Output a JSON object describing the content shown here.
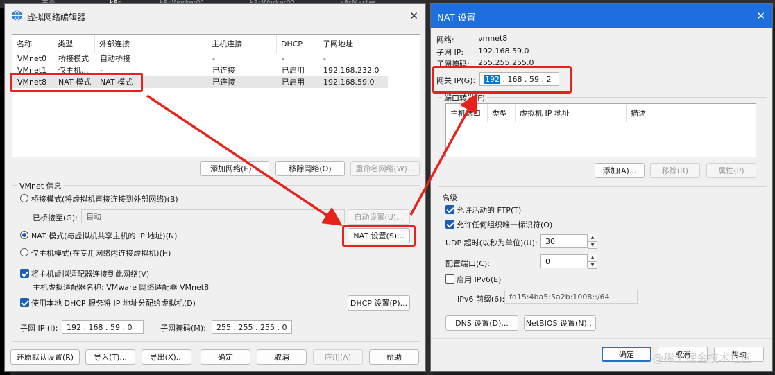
{
  "background": {
    "tabs": [
      "主页",
      "k8s",
      "k8sWorker01",
      "k8sWorker02",
      "k8sMaster"
    ]
  },
  "left_window": {
    "title": "虚拟网络编辑器",
    "icon": "globe-icon",
    "table": {
      "headers": [
        "名称",
        "类型",
        "外部连接",
        "主机连接",
        "DHCP",
        "子网地址"
      ],
      "rows": [
        [
          "VMnet0",
          "桥接模式",
          "自动桥接",
          "-",
          "-",
          "-"
        ],
        [
          "VMnet1",
          "仅主机...",
          "-",
          "已连接",
          "已启用",
          "192.168.232.0"
        ],
        [
          "VMnet8",
          "NAT 模式",
          "NAT 模式",
          "已连接",
          "已启用",
          "192.168.59.0"
        ]
      ]
    },
    "list_buttons": {
      "add": "添加网络(E)...",
      "remove": "移除网络(O)",
      "rename": "重命名网络(W)..."
    },
    "info_label": "VMnet 信息",
    "bridge_radio": "桥接模式(将虚拟机直接连接到外部网络)(B)",
    "bridged_to_label": "已桥接至(G):",
    "bridged_to_value": "自动",
    "auto_settings": "自动设置(U)...",
    "nat_radio": "NAT 模式(与虚拟机共享主机的 IP 地址)(N)",
    "nat_settings": "NAT 设置(S)...",
    "hostonly_radio": "仅主机模式(在专用网络内连接虚拟机)(H)",
    "connect_adapter": "将主机虚拟适配器连接到此网络(V)",
    "adapter_name": "主机虚拟适配器名称: VMware 网络适配器 VMnet8",
    "use_dhcp": "使用本地 DHCP 服务将 IP 地址分配给虚拟机(D)",
    "dhcp_settings": "DHCP 设置(P)...",
    "subnet_ip_label": "子网 IP (I):",
    "subnet_ip": "192 . 168 . 59 . 0",
    "subnet_mask_label": "子网掩码(M):",
    "subnet_mask": "255 . 255 . 255 . 0",
    "footer": {
      "restore": "还原默认设置(R)",
      "import": "导入(T)...",
      "export": "导出(X)...",
      "ok": "确定",
      "cancel": "取消",
      "apply": "应用(A)",
      "help": "帮助"
    }
  },
  "nat_window": {
    "title": "NAT 设置",
    "network_label": "网络:",
    "network_value": "vmnet8",
    "subnet_ip_label": "子网 IP:",
    "subnet_ip_value": "192.168.59.0",
    "subnet_mask_label": "子网掩码:",
    "subnet_mask_value": "255.255.255.0",
    "gateway_label": "网关 IP(G):",
    "gateway_first": "192",
    "gateway_rest": " . 168 . 59 . 2",
    "port_forward_label": "端口转发(F)",
    "pf_headers": [
      "主机端口",
      "类型",
      "虚拟机 IP 地址",
      "描述"
    ],
    "pf_buttons": {
      "add": "添加(A)...",
      "remove": "移除(R)",
      "props": "属性(P)"
    },
    "advanced_label": "高级",
    "allow_ftp": "允许活动的 FTP(T)",
    "allow_uuid": "允许任何组织唯一标识符(O)",
    "udp_label": "UDP 超时(以秒为单位)(U):",
    "udp_value": "30",
    "config_port_label": "配置端口(C):",
    "config_port_value": "0",
    "enable_ipv6": "启用 IPv6(E)",
    "ipv6_prefix_label": "IPv6 前缀(6):",
    "ipv6_prefix_value": "fd15:4ba5:5a2b:1008::/64",
    "dns_settings": "DNS 设置(D)...",
    "netbios_settings": "NetBIOS 设置(N)...",
    "ok": "确定",
    "cancel": "取消",
    "help": "帮助"
  },
  "watermark": "@稀土掘金技术社区",
  "colors": {
    "annotation_red": "#e8221b",
    "check_blue": "#1a5fb4"
  }
}
